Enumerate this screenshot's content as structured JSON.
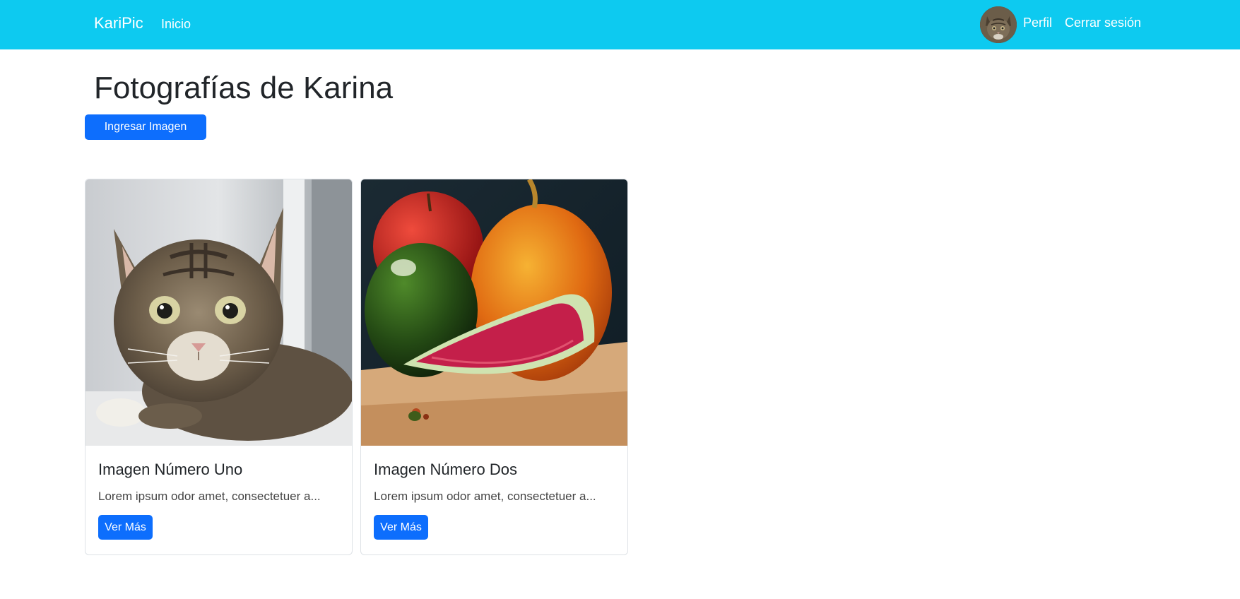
{
  "navbar": {
    "brand": "KariPic",
    "home_label": "Inicio",
    "profile_label": "Perfil",
    "logout_label": "Cerrar sesión",
    "background_color": "#0dcaf0"
  },
  "main": {
    "title": "Fotografías de Karina",
    "upload_button_label": "Ingresar Imagen"
  },
  "cards": [
    {
      "title": "Imagen Número Uno",
      "text": "Lorem ipsum odor amet, consectetuer a...",
      "button_label": "Ver Más"
    },
    {
      "title": "Imagen Número Dos",
      "text": "Lorem ipsum odor amet, consectetuer a...",
      "button_label": "Ver Más"
    }
  ],
  "colors": {
    "primary": "#0d6efd",
    "navbar": "#0dcaf0"
  }
}
